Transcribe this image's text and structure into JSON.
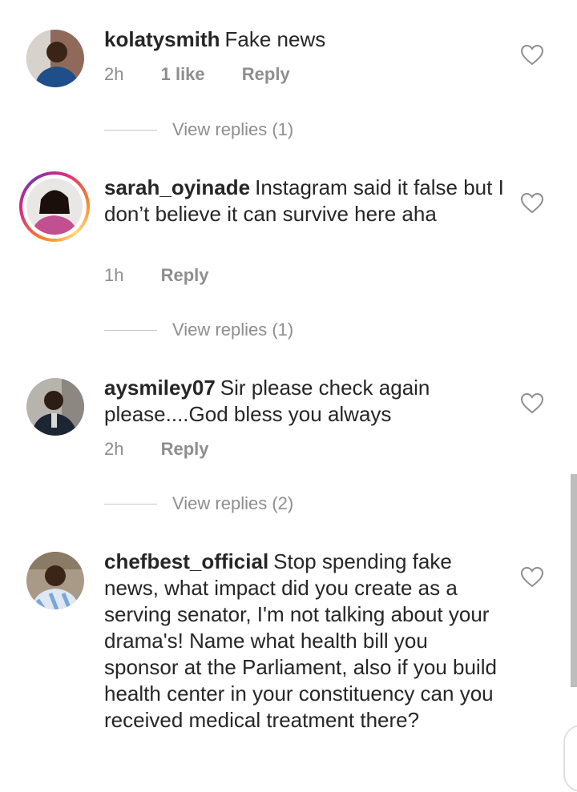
{
  "comments": [
    {
      "username": "kolatysmith",
      "text": "Fake news",
      "time": "2h",
      "likes": "1 like",
      "reply_label": "Reply",
      "view_replies": "View replies (1)",
      "avatar_icon": "profile-photo-man-blue-shirt"
    },
    {
      "username": "sarah_oyinade",
      "text": "Instagram said it false but I don’t believe it can survive here aha",
      "time": "1h",
      "reply_label": "Reply",
      "view_replies": "View replies (1)",
      "avatar_icon": "profile-photo-woman-pink-top"
    },
    {
      "username": "aysmiley07",
      "text": "Sir please check again please....God bless you always",
      "time": "2h",
      "reply_label": "Reply",
      "view_replies": "View replies (2)",
      "avatar_icon": "profile-photo-man-dark-jacket"
    },
    {
      "username": "chefbest_official",
      "text": "Stop spending fake news, what impact did you create as a serving senator, I'm not talking about your drama's! Name what health bill you sponsor at the Parliament, also if you build health center in your constituency can you received medical treatment there?",
      "avatar_icon": "profile-photo-man-striped-jersey"
    }
  ],
  "colors": {
    "text": "#262626",
    "muted": "#8e8e8e",
    "story_ring": [
      "#f58529",
      "#dd2a7b",
      "#8134af"
    ]
  },
  "icons": {
    "like": "heart-outline-icon"
  }
}
